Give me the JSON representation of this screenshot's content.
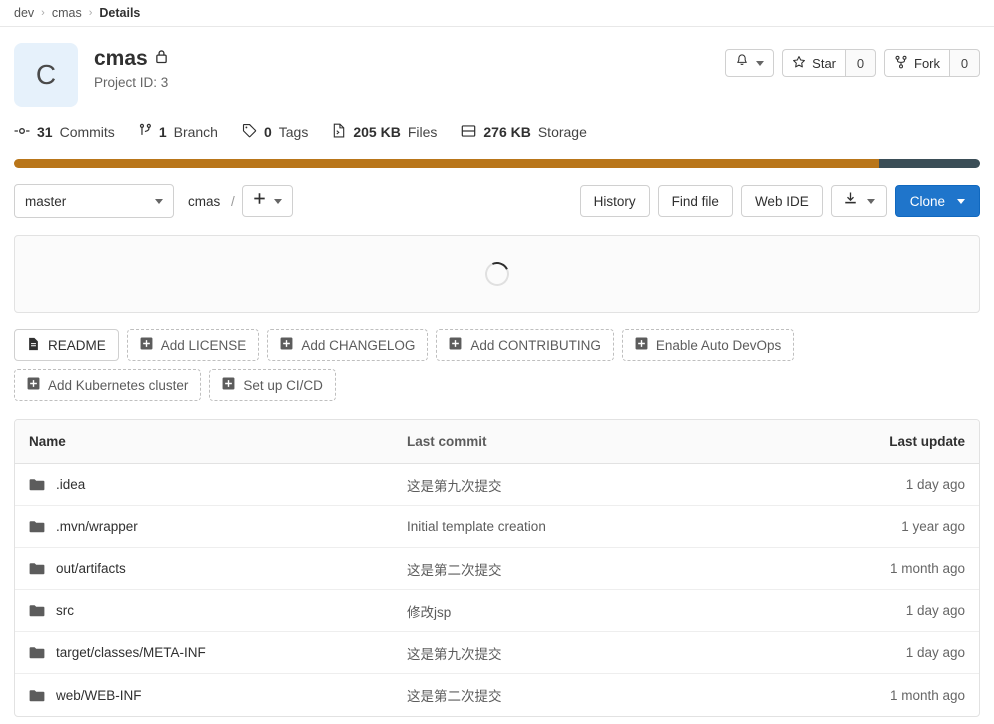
{
  "breadcrumb": {
    "items": [
      "dev",
      "cmas",
      "Details"
    ],
    "separator": "›"
  },
  "project": {
    "avatar_letter": "C",
    "avatar_bg": "#e6f1fb",
    "name": "cmas",
    "visibility_icon": "lock-icon",
    "project_id_label": "Project ID: 3"
  },
  "header_actions": {
    "notifications_icon": "bell-icon",
    "star_label": "Star",
    "star_count": "0",
    "fork_label": "Fork",
    "fork_count": "0"
  },
  "stats": [
    {
      "icon": "commit-icon",
      "value": "31",
      "label": "Commits"
    },
    {
      "icon": "branch-icon",
      "value": "1",
      "label": "Branch"
    },
    {
      "icon": "tag-icon",
      "value": "0",
      "label": "Tags"
    },
    {
      "icon": "file-icon",
      "value": "205 KB",
      "label": "Files"
    },
    {
      "icon": "storage-icon",
      "value": "276 KB",
      "label": "Storage"
    }
  ],
  "language_bar": [
    {
      "name": "primary",
      "color": "#b9761a",
      "percent": 89.5
    },
    {
      "name": "secondary",
      "color": "#3b4e57",
      "percent": 10.5
    }
  ],
  "ref_toolbar": {
    "branch": "master",
    "path_root": "cmas",
    "path_separator": "/",
    "add_icon": "plus-icon",
    "history_label": "History",
    "find_file_label": "Find file",
    "web_ide_label": "Web IDE",
    "download_icon": "download-icon",
    "clone_label": "Clone"
  },
  "readme_panel": {
    "state_icon": "loading-spinner"
  },
  "quick_actions": [
    {
      "label": "README",
      "icon": "document-icon",
      "style": "solid"
    },
    {
      "label": "Add LICENSE",
      "icon": "plus-box-icon",
      "style": "dashed"
    },
    {
      "label": "Add CHANGELOG",
      "icon": "plus-box-icon",
      "style": "dashed"
    },
    {
      "label": "Add CONTRIBUTING",
      "icon": "plus-box-icon",
      "style": "dashed"
    },
    {
      "label": "Enable Auto DevOps",
      "icon": "plus-box-icon",
      "style": "dashed"
    },
    {
      "label": "Add Kubernetes cluster",
      "icon": "plus-box-icon",
      "style": "dashed"
    },
    {
      "label": "Set up CI/CD",
      "icon": "plus-box-icon",
      "style": "dashed"
    }
  ],
  "file_table": {
    "columns": {
      "name": "Name",
      "last_commit": "Last commit",
      "last_update": "Last update"
    },
    "rows": [
      {
        "icon": "folder-icon",
        "name": ".idea",
        "commit": "这是第九次提交",
        "updated": "1 day ago"
      },
      {
        "icon": "folder-icon",
        "name": ".mvn/wrapper",
        "commit": "Initial template creation",
        "updated": "1 year ago"
      },
      {
        "icon": "folder-icon",
        "name": "out/artifacts",
        "commit": "这是第二次提交",
        "updated": "1 month ago"
      },
      {
        "icon": "folder-icon",
        "name": "src",
        "commit": "修改jsp",
        "updated": "1 day ago"
      },
      {
        "icon": "folder-icon",
        "name": "target/classes/META-INF",
        "commit": "这是第九次提交",
        "updated": "1 day ago"
      },
      {
        "icon": "folder-icon",
        "name": "web/WEB-INF",
        "commit": "这是第二次提交",
        "updated": "1 month ago"
      }
    ]
  }
}
